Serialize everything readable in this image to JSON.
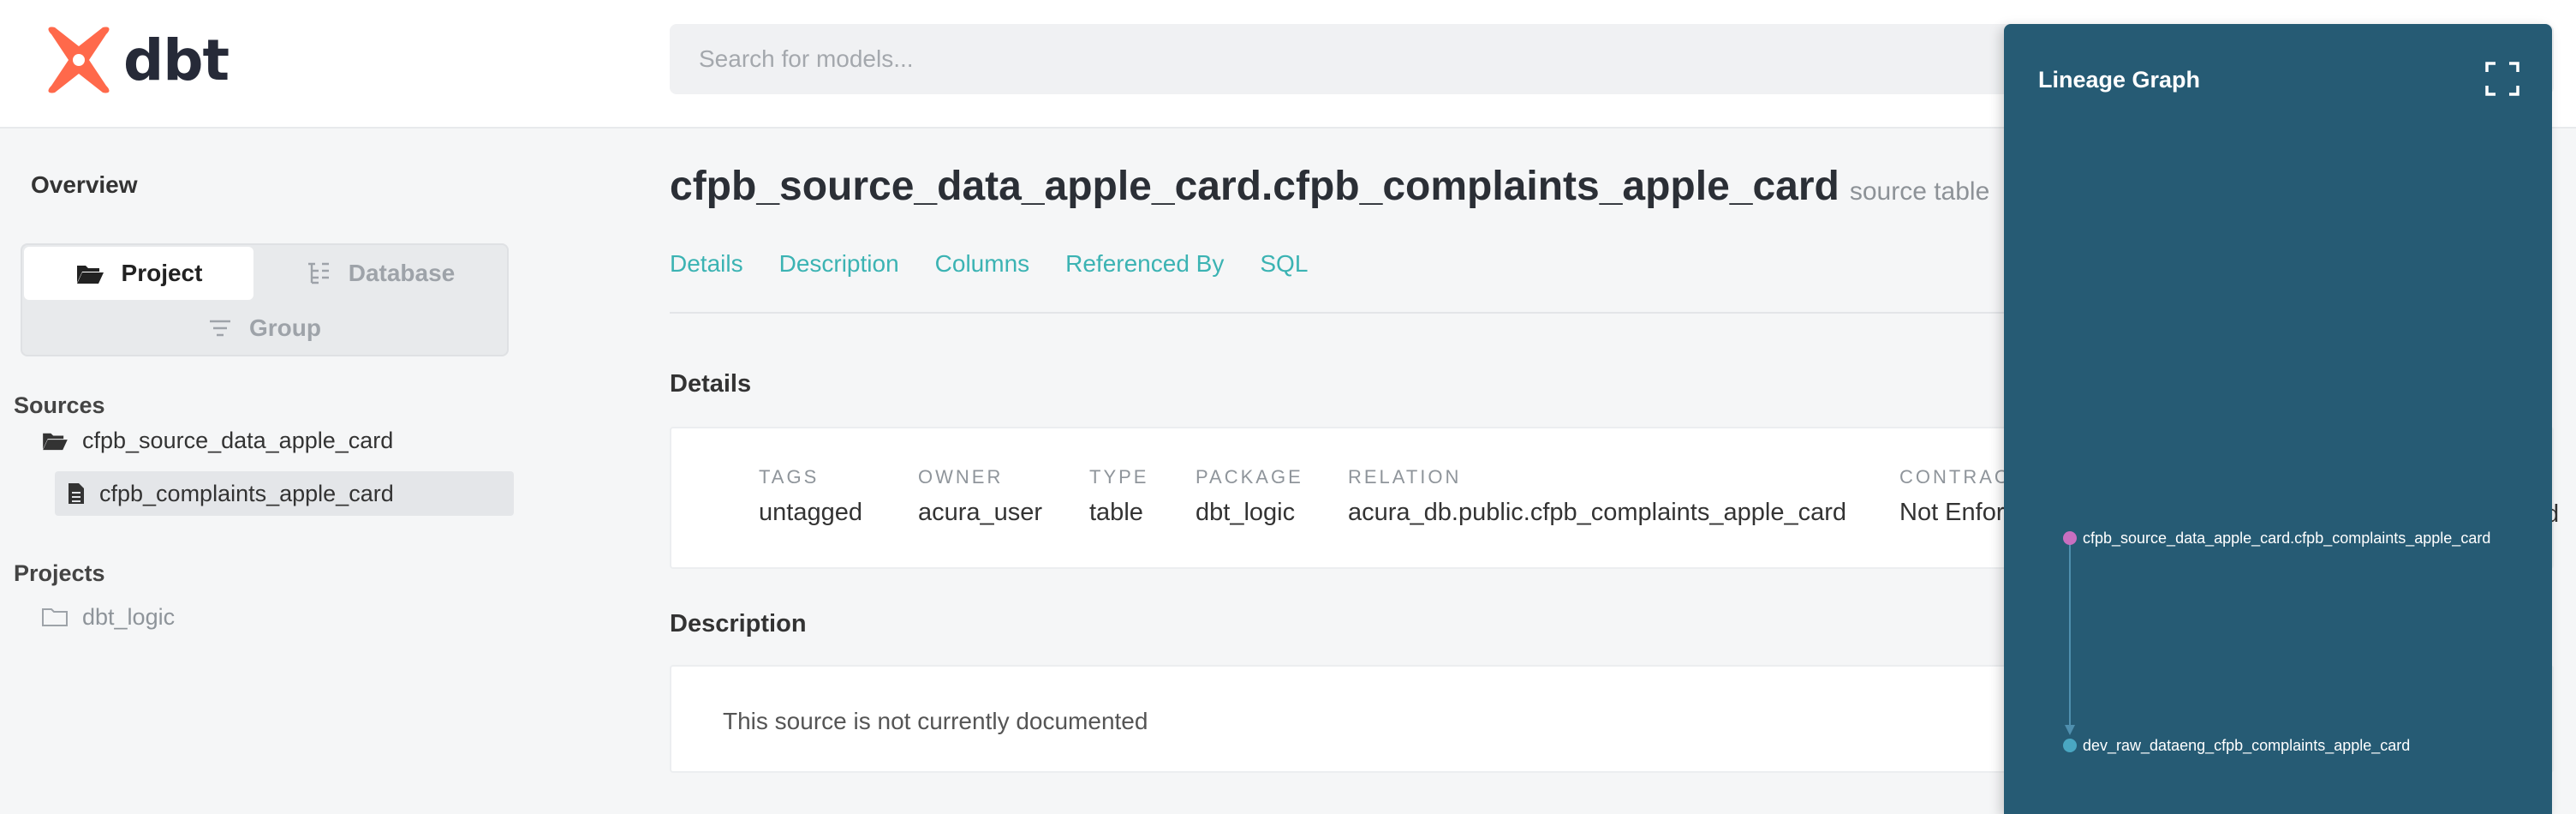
{
  "brand": {
    "name": "dbt",
    "logo_color": "#ff694b"
  },
  "search": {
    "placeholder": "Search for models..."
  },
  "sidebar": {
    "overview": "Overview",
    "toggle": {
      "project": "Project",
      "database": "Database",
      "group": "Group"
    },
    "sources_title": "Sources",
    "source_folder": "cfpb_source_data_apple_card",
    "source_table": "cfpb_complaints_apple_card",
    "projects_title": "Projects",
    "project_item": "dbt_logic"
  },
  "main": {
    "title": "cfpb_source_data_apple_card.cfpb_complaints_apple_card",
    "subtitle": "source table",
    "tabs": [
      "Details",
      "Description",
      "Columns",
      "Referenced By",
      "SQL"
    ],
    "details_heading": "Details",
    "details": [
      {
        "key": "TAGS",
        "value": "untagged"
      },
      {
        "key": "OWNER",
        "value": "acura_user"
      },
      {
        "key": "TYPE",
        "value": "table"
      },
      {
        "key": "PACKAGE",
        "value": "dbt_logic"
      },
      {
        "key": "RELATION",
        "value": "acura_db.public.cfpb_complaints_apple_card"
      },
      {
        "key": "CONTRACT",
        "value": "Not Enforced"
      }
    ],
    "overflow_fragment": "d",
    "description_heading": "Description",
    "description_text": "This source is not currently documented"
  },
  "lineage": {
    "title": "Lineage Graph",
    "panel_color": "#265b74",
    "nodes": [
      {
        "label": "cfpb_source_data_apple_card.cfpb_complaints_apple_card",
        "color": "#c96fc0"
      },
      {
        "label": "dev_raw_dataeng_cfpb_complaints_apple_card",
        "color": "#4aa7c2"
      }
    ]
  },
  "colors": {
    "accent": "#3bb3b3",
    "text": "#333333"
  }
}
